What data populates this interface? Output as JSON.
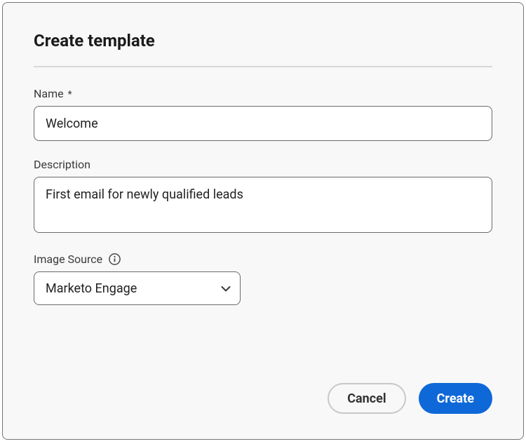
{
  "dialog": {
    "title": "Create template"
  },
  "fields": {
    "name": {
      "label": "Name",
      "required_mark": "*",
      "value": "Welcome"
    },
    "description": {
      "label": "Description",
      "value": "First email for newly qualified leads"
    },
    "imageSource": {
      "label": "Image Source",
      "selected": "Marketo Engage"
    }
  },
  "buttons": {
    "cancel": "Cancel",
    "create": "Create"
  },
  "colors": {
    "primary": "#0f68d8"
  }
}
